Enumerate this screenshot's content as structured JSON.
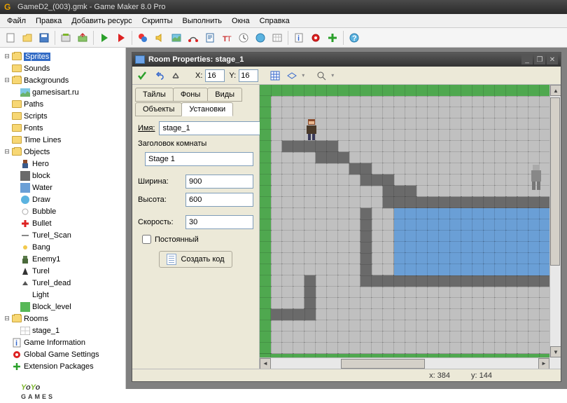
{
  "titlebar": {
    "title": "GameD2_(003).gmk - Game Maker 8.0 Pro"
  },
  "menu": {
    "file": "Файл",
    "edit": "Правка",
    "add": "Добавить ресурс",
    "scripts": "Скрипты",
    "run": "Выполнить",
    "windows": "Окна",
    "help": "Справка"
  },
  "tree": {
    "sprites": "Sprites",
    "sounds": "Sounds",
    "backgrounds": "Backgrounds",
    "bg1": "gamesisart.ru",
    "paths": "Paths",
    "scripts": "Scripts",
    "fonts": "Fonts",
    "timelines": "Time Lines",
    "objects": "Objects",
    "obj": [
      "Hero",
      "block",
      "Water",
      "Draw",
      "Bubble",
      "Bullet",
      "Turel_Scan",
      "Bang",
      "Enemy1",
      "Turel",
      "Turel_dead",
      "Light",
      "Block_level"
    ],
    "rooms": "Rooms",
    "room1": "stage_1",
    "gameinfo": "Game Information",
    "ggs": "Global Game Settings",
    "ext": "Extension Packages"
  },
  "room": {
    "winTitle": "Room Properties: stage_1",
    "snapX_lbl": "X:",
    "snapX": "16",
    "snapY_lbl": "Y:",
    "snapY": "16",
    "tabs": {
      "tiles": "Тайлы",
      "bg": "Фоны",
      "views": "Виды",
      "objects": "Объекты",
      "settings": "Установки"
    },
    "form": {
      "name_lbl": "Имя:",
      "name": "stage_1",
      "caption_lbl": "Заголовок комнаты",
      "caption": "Stage 1",
      "width_lbl": "Ширина:",
      "width": "900",
      "height_lbl": "Высота:",
      "height": "600",
      "speed_lbl": "Скорость:",
      "speed": "30",
      "persistent": "Постоянный",
      "create_code": "Создать код"
    },
    "status": {
      "x": "x: 384",
      "y": "y: 144"
    }
  },
  "logo": {
    "brand1": "YoYo",
    "brand2": "GAMES"
  }
}
